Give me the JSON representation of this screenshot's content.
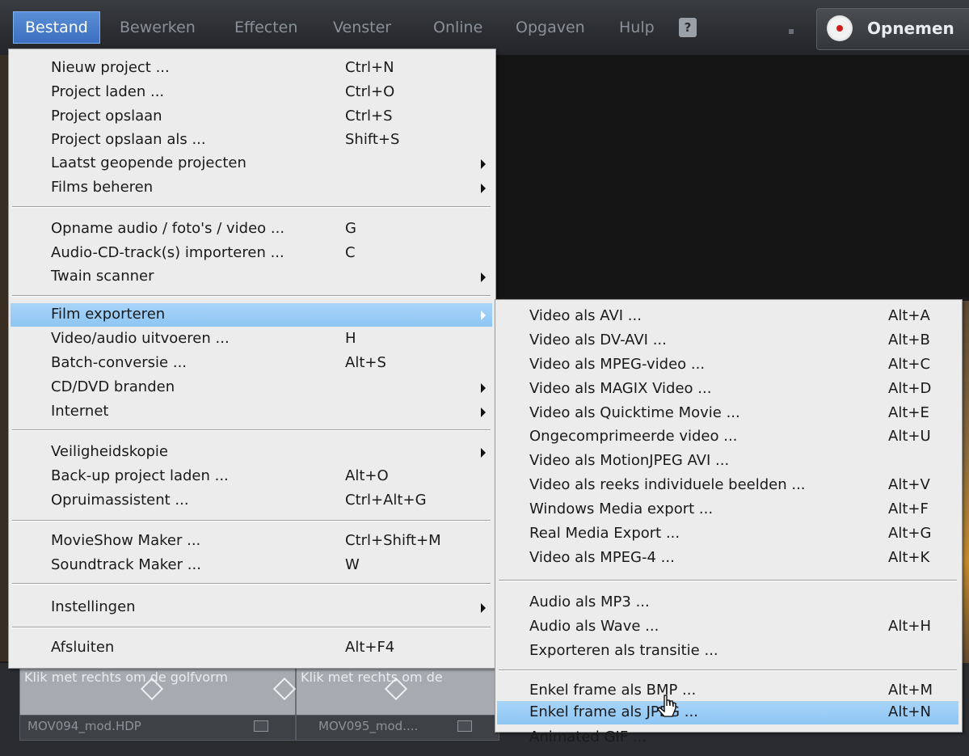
{
  "menubar": {
    "items": [
      {
        "label": "Bestand"
      },
      {
        "label": "Bewerken"
      },
      {
        "label": "Effecten"
      },
      {
        "label": "Venster"
      },
      {
        "label": "Online"
      },
      {
        "label": "Opgaven"
      },
      {
        "label": "Hulp"
      }
    ],
    "record_label": "Opnemen"
  },
  "bestand_menu": {
    "items": [
      {
        "label": "Nieuw project ...",
        "shortcut": "Ctrl+N"
      },
      {
        "label": "Project laden ...",
        "shortcut": "Ctrl+O"
      },
      {
        "label": "Project opslaan",
        "shortcut": "Ctrl+S"
      },
      {
        "label": "Project opslaan als ...",
        "shortcut": "Shift+S"
      },
      {
        "label": "Laatst geopende projecten",
        "shortcut": ""
      },
      {
        "label": "Films beheren",
        "shortcut": ""
      },
      {
        "label": "Opname audio / foto's / video ...",
        "shortcut": "G"
      },
      {
        "label": "Audio-CD-track(s) importeren ...",
        "shortcut": "C"
      },
      {
        "label": "Twain scanner",
        "shortcut": ""
      },
      {
        "label": "Film exporteren",
        "shortcut": ""
      },
      {
        "label": "Video/audio uitvoeren ...",
        "shortcut": "H"
      },
      {
        "label": "Batch-conversie ...",
        "shortcut": "Alt+S"
      },
      {
        "label": "CD/DVD branden",
        "shortcut": ""
      },
      {
        "label": "Internet",
        "shortcut": ""
      },
      {
        "label": "Veiligheidskopie",
        "shortcut": ""
      },
      {
        "label": "Back-up project laden ...",
        "shortcut": "Alt+O"
      },
      {
        "label": "Opruimassistent ...",
        "shortcut": "Ctrl+Alt+G"
      },
      {
        "label": "MovieShow Maker ...",
        "shortcut": "Ctrl+Shift+M"
      },
      {
        "label": "Soundtrack Maker ...",
        "shortcut": "W"
      },
      {
        "label": "Instellingen",
        "shortcut": ""
      },
      {
        "label": "Afsluiten",
        "shortcut": "Alt+F4"
      }
    ]
  },
  "export_submenu": {
    "items": [
      {
        "label": "Video als AVI ...",
        "shortcut": "Alt+A"
      },
      {
        "label": "Video als DV-AVI ...",
        "shortcut": "Alt+B"
      },
      {
        "label": "Video als MPEG-video ...",
        "shortcut": "Alt+C"
      },
      {
        "label": "Video als MAGIX Video ...",
        "shortcut": "Alt+D"
      },
      {
        "label": "Video als Quicktime Movie ...",
        "shortcut": "Alt+E"
      },
      {
        "label": "Ongecomprimeerde video ...",
        "shortcut": "Alt+U"
      },
      {
        "label": "Video als MotionJPEG AVI ...",
        "shortcut": ""
      },
      {
        "label": "Video als reeks individuele beelden ...",
        "shortcut": "Alt+V"
      },
      {
        "label": "Windows Media export ...",
        "shortcut": "Alt+F"
      },
      {
        "label": "Real Media Export ...",
        "shortcut": "Alt+G"
      },
      {
        "label": "Video als MPEG-4 ...",
        "shortcut": "Alt+K"
      },
      {
        "label": "Audio als MP3 ...",
        "shortcut": ""
      },
      {
        "label": "Audio als Wave ...",
        "shortcut": "Alt+H"
      },
      {
        "label": "Exporteren als transitie ...",
        "shortcut": ""
      },
      {
        "label": "Enkel frame als BMP ...",
        "shortcut": "Alt+M"
      },
      {
        "label": "Enkel frame als JPEG ...",
        "shortcut": "Alt+N"
      },
      {
        "label": "Animated GIF ...",
        "shortcut": ""
      }
    ]
  },
  "timeline": {
    "clips": [
      {
        "hint": "Klik met rechts om de golfvorm",
        "name": "MOV094_mod.HDP"
      },
      {
        "hint": "Klik met rechts om de",
        "name": "MOV095_mod...."
      }
    ]
  },
  "colors": {
    "menu_bg": "#ececec",
    "highlight": "#99ccf5",
    "menubar_active": "#4a80cc"
  }
}
